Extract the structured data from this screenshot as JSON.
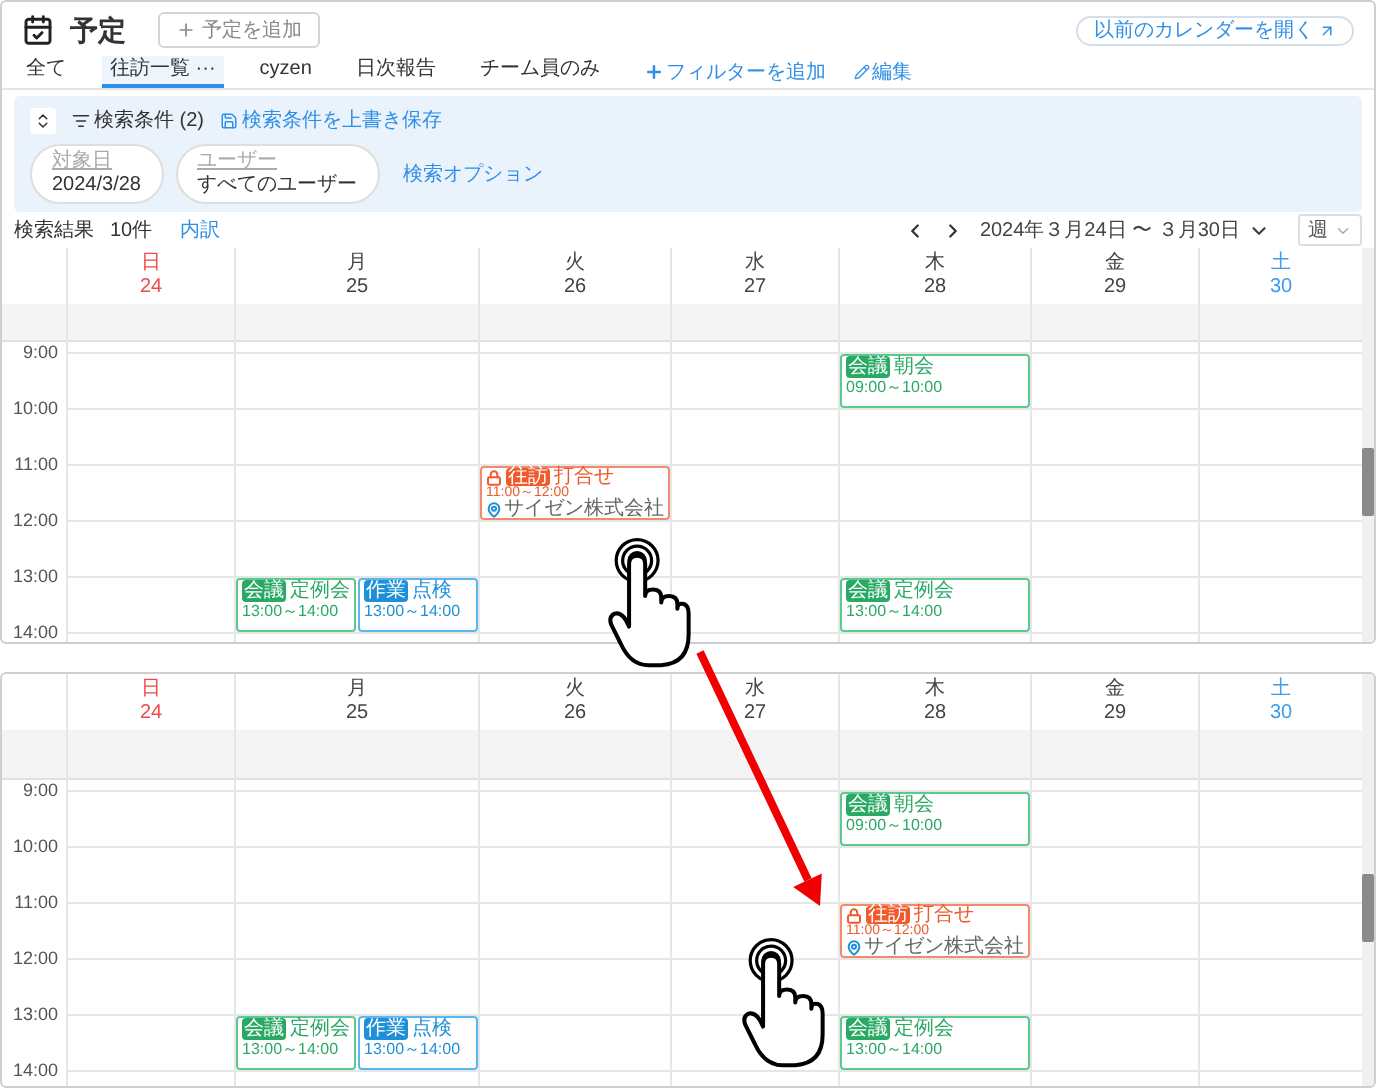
{
  "top_screen": {
    "title": "予定",
    "add_button": "予定を追加",
    "old_calendar_link": "以前のカレンダーを開く",
    "tabs": [
      {
        "label": "全て",
        "selected": false
      },
      {
        "label": "往訪一覧",
        "more": "···",
        "selected": true
      },
      {
        "label": "cyzen",
        "selected": false
      },
      {
        "label": "日次報告",
        "selected": false
      },
      {
        "label": "チーム員のみ",
        "selected": false
      }
    ],
    "add_filter": "フィルターを追加",
    "edit": "編集",
    "search": {
      "conditions": "検索条件 (2)",
      "save": "検索条件を上書き保存",
      "options": "検索オプション",
      "chips": [
        {
          "label": "対象日",
          "value": "2024/3/28"
        },
        {
          "label": "ユーザー",
          "value": "すべてのユーザー"
        }
      ]
    },
    "results": {
      "label": "検索結果",
      "count": "10件",
      "breakdown": "内訳"
    },
    "range": "2024年３月24日 〜 ３月30日",
    "view": "週",
    "calendar": {
      "days": [
        {
          "weekday": "日",
          "date": "24",
          "color": "#f04a4a"
        },
        {
          "weekday": "月",
          "date": "25",
          "color": "#444444"
        },
        {
          "weekday": "火",
          "date": "26",
          "color": "#444444"
        },
        {
          "weekday": "水",
          "date": "27",
          "color": "#444444"
        },
        {
          "weekday": "木",
          "date": "28",
          "color": "#444444"
        },
        {
          "weekday": "金",
          "date": "29",
          "color": "#444444"
        },
        {
          "weekday": "土",
          "date": "30",
          "color": "#3b9cf0"
        }
      ],
      "hours": [
        {
          "label": "9:00",
          "cells": [
            [],
            [],
            [],
            [],
            [
              {
                "kind": "meeting",
                "tag": "会議",
                "title": "朝会",
                "time": "09:00～10:00"
              }
            ],
            [],
            []
          ]
        },
        {
          "label": "10:00",
          "cells": [
            [],
            [],
            [],
            [],
            [],
            [],
            []
          ]
        },
        {
          "label": "11:00",
          "cells": [
            [],
            [],
            [
              {
                "kind": "visit",
                "tag": "往訪",
                "title": "打合せ",
                "time": "11:00～12:00",
                "location": "サイゼン株式会社"
              }
            ],
            [],
            [],
            [],
            []
          ]
        },
        {
          "label": "12:00",
          "cells": [
            [],
            [],
            [],
            [],
            [],
            [],
            []
          ]
        },
        {
          "label": "13:00",
          "cells": [
            [],
            [
              {
                "kind": "meeting",
                "tag": "会議",
                "title": "定例会",
                "time": "13:00～14:00"
              },
              {
                "kind": "work",
                "tag": "作業",
                "title": "点検",
                "time": "13:00～14:00"
              }
            ],
            [],
            [],
            [
              {
                "kind": "meeting",
                "tag": "会議",
                "title": "定例会",
                "time": "13:00～14:00"
              }
            ],
            [],
            []
          ]
        },
        {
          "label": "14:00",
          "cells": [
            [],
            [],
            [],
            [],
            [],
            [],
            []
          ]
        }
      ]
    }
  },
  "bottom_screen": {
    "calendar": {
      "days": [
        {
          "weekday": "日",
          "date": "24",
          "color": "#f04a4a"
        },
        {
          "weekday": "月",
          "date": "25",
          "color": "#444444"
        },
        {
          "weekday": "火",
          "date": "26",
          "color": "#444444"
        },
        {
          "weekday": "水",
          "date": "27",
          "color": "#444444"
        },
        {
          "weekday": "木",
          "date": "28",
          "color": "#444444"
        },
        {
          "weekday": "金",
          "date": "29",
          "color": "#444444"
        },
        {
          "weekday": "土",
          "date": "30",
          "color": "#3b9cf0"
        }
      ],
      "hours": [
        {
          "label": "9:00",
          "cells": [
            [],
            [],
            [],
            [],
            [
              {
                "kind": "meeting",
                "tag": "会議",
                "title": "朝会",
                "time": "09:00～10:00"
              }
            ],
            [],
            []
          ]
        },
        {
          "label": "10:00",
          "cells": [
            [],
            [],
            [],
            [],
            [],
            [],
            []
          ]
        },
        {
          "label": "11:00",
          "cells": [
            [],
            [],
            [],
            [],
            [
              {
                "kind": "visit",
                "tag": "往訪",
                "title": "打合せ",
                "time": "11:00～12:00",
                "location": "サイゼン株式会社"
              }
            ],
            [],
            []
          ]
        },
        {
          "label": "12:00",
          "cells": [
            [],
            [],
            [],
            [],
            [],
            [],
            []
          ]
        },
        {
          "label": "13:00",
          "cells": [
            [],
            [
              {
                "kind": "meeting",
                "tag": "会議",
                "title": "定例会",
                "time": "13:00～14:00"
              },
              {
                "kind": "work",
                "tag": "作業",
                "title": "点検",
                "time": "13:00～14:00"
              }
            ],
            [],
            [],
            [
              {
                "kind": "meeting",
                "tag": "会議",
                "title": "定例会",
                "time": "13:00～14:00"
              }
            ],
            [],
            []
          ]
        },
        {
          "label": "14:00",
          "cells": [
            [],
            [],
            [],
            [],
            [],
            [],
            []
          ]
        }
      ]
    }
  }
}
